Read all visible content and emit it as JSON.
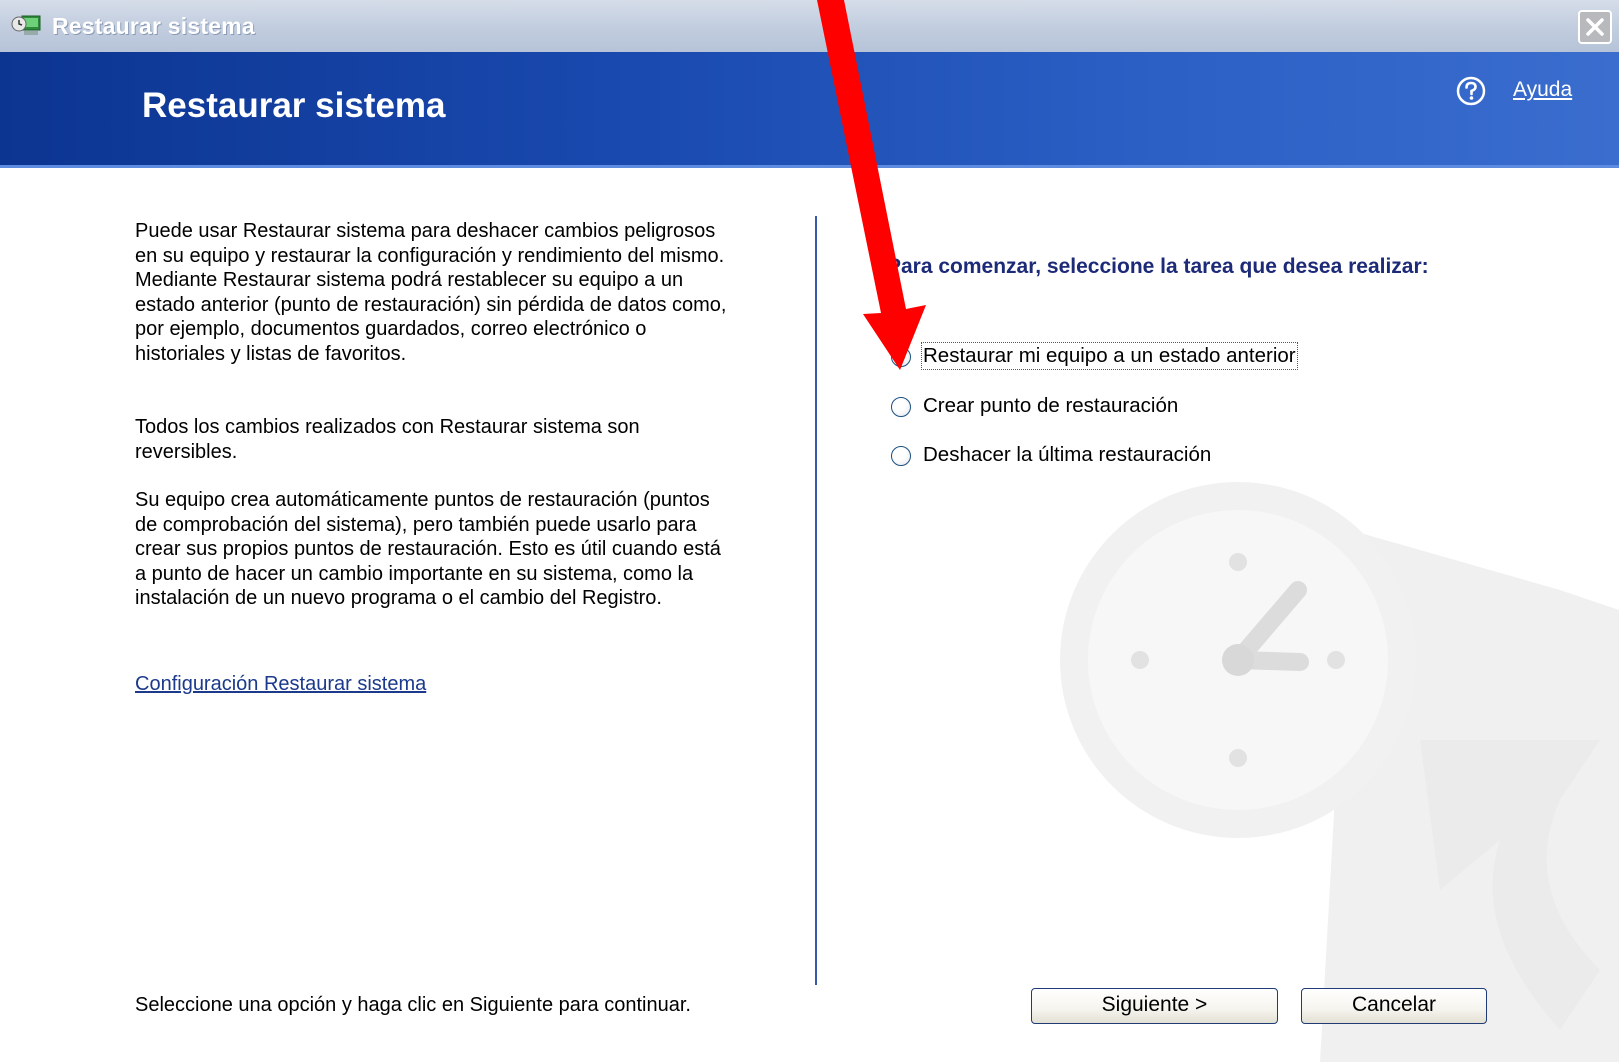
{
  "window": {
    "title": "Restaurar sistema",
    "close_icon": "close-icon"
  },
  "header": {
    "title": "Restaurar sistema",
    "help_label": "Ayuda",
    "help_icon": "help-icon"
  },
  "left": {
    "paragraph1": "Puede usar Restaurar sistema para deshacer cambios peligrosos en su equipo y restaurar la configuración y rendimiento del mismo. Mediante Restaurar sistema podrá restablecer su equipo a un estado anterior (punto de restauración) sin pérdida de datos como, por ejemplo, documentos guardados, correo electrónico o historiales y listas de favoritos.",
    "paragraph2": "Todos los cambios realizados con Restaurar sistema son reversibles.",
    "paragraph3": "Su equipo crea automáticamente puntos de restauración (puntos de comprobación del sistema), pero también puede usarlo para crear sus propios puntos de restauración. Esto es útil cuando está a punto de hacer un cambio importante en su sistema, como la instalación de un nuevo programa o el cambio del Registro.",
    "config_link": "Configuración Restaurar sistema",
    "footer": "Seleccione una opción y haga clic en Siguiente para continuar."
  },
  "right": {
    "prompt": "Para comenzar, seleccione la tarea que desea realizar:",
    "options": [
      {
        "label": "Restaurar mi equipo a un estado anterior",
        "selected": true
      },
      {
        "label": "Crear punto de restauración",
        "selected": false
      },
      {
        "label": "Deshacer la última restauración",
        "selected": false
      }
    ]
  },
  "buttons": {
    "next": "Siguiente >",
    "cancel": "Cancelar"
  },
  "colors": {
    "header_blue": "#1a4ab0",
    "arrow_red": "#ff0000",
    "prompt_text": "#1c2a78"
  }
}
